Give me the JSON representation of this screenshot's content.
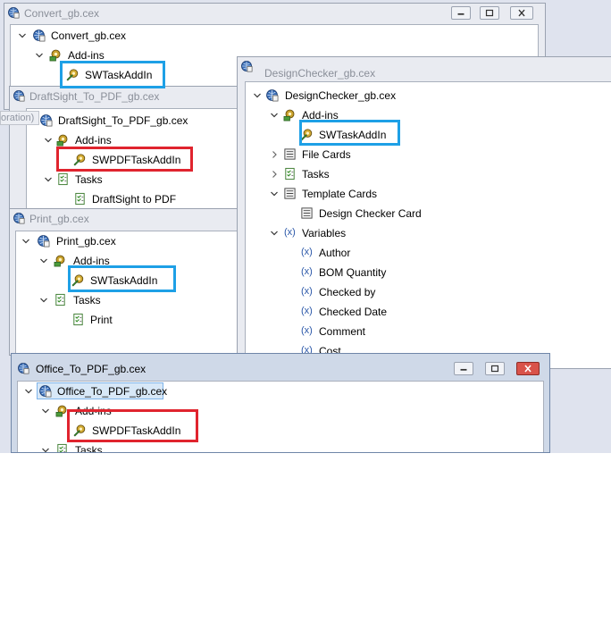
{
  "colors": {
    "highlight_blue": "#1ea0e6",
    "highlight_red": "#e0242e",
    "background": "#dfe3ee"
  },
  "icons": {
    "config": "cex-file-icon",
    "addins": "addins-gear-icon",
    "addin": "addin-gear-icon",
    "tasks": "tasks-checklist-icon",
    "task": "task-checklist-icon",
    "cards": "card-icon",
    "variable": "variable-x-icon"
  },
  "fragment_text": "oration)",
  "convert": {
    "title": "Convert_gb.cex",
    "root": "Convert_gb.cex",
    "addins": "Add-ins",
    "addin": "SWTaskAddIn"
  },
  "draftsight": {
    "title": "DraftSight_To_PDF_gb.cex",
    "root": "DraftSight_To_PDF_gb.cex",
    "addins": "Add-ins",
    "addin": "SWPDFTaskAddIn",
    "tasks": "Tasks",
    "task": "DraftSight to PDF"
  },
  "print": {
    "title": "Print_gb.cex",
    "root": "Print_gb.cex",
    "addins": "Add-ins",
    "addin": "SWTaskAddIn",
    "tasks": "Tasks",
    "task": "Print"
  },
  "designchecker": {
    "title": "DesignChecker_gb.cex",
    "root": "DesignChecker_gb.cex",
    "addins": "Add-ins",
    "addin": "SWTaskAddIn",
    "file_cards": "File Cards",
    "tasks": "Tasks",
    "template_cards": "Template Cards",
    "card": "Design Checker Card",
    "variables": "Variables",
    "variable_items": [
      "Author",
      "BOM Quantity",
      "Checked by",
      "Checked Date",
      "Comment",
      "Cost"
    ]
  },
  "office": {
    "title": "Office_To_PDF_gb.cex",
    "root": "Office_To_PDF_gb.cex",
    "addins": "Add-ins",
    "addin": "SWPDFTaskAddIn",
    "tasks": "Tasks"
  }
}
